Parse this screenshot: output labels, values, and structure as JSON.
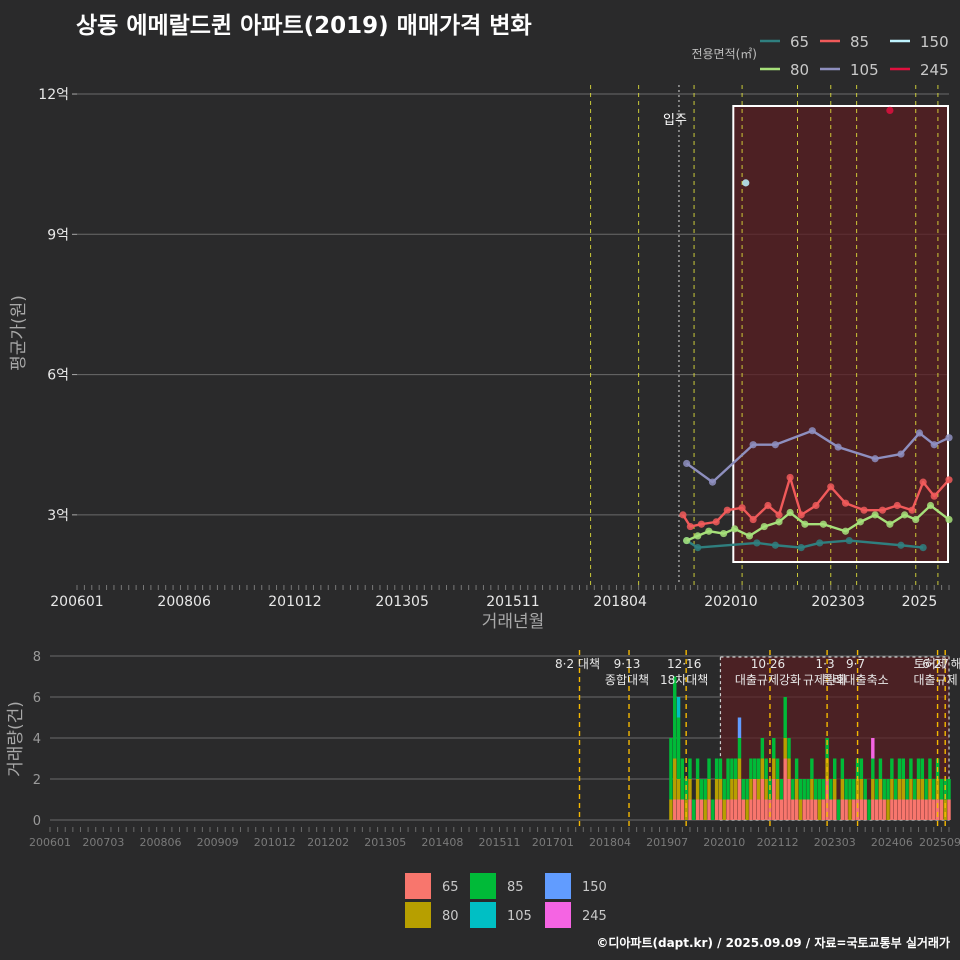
{
  "title": "상동 에메랄드퀸 아파트(2019) 매매가격 변화",
  "footer": "©디아파트(dapt.kr) / 2025.09.09 / 자료=국토교통부 실거래가",
  "colors": {
    "background": "#2a2a2b",
    "grid": "#6b6b6b",
    "axis_text": "#e8e8e8",
    "policy_line": "#f5b800",
    "highlight_fill": "#5a1e22",
    "highlight_border": "#ffffff",
    "line_colors": {
      "65": "#2f7f7f",
      "80": "#a6e07a",
      "85": "#f05a5a",
      "105": "#8e8fbf",
      "150": "#bff4ff",
      "245": "#e0103e"
    },
    "bar_colors": {
      "65": "#f8766d",
      "80": "#b79f00",
      "85": "#00ba38",
      "105": "#00bfc4",
      "150": "#619cff",
      "245": "#f564e3"
    }
  },
  "chart_data": [
    {
      "type": "line",
      "title": "",
      "xlabel": "거래년월",
      "ylabel": "평균가(원)",
      "legend_title": "전용면적(㎡)",
      "legend_position": "top-right",
      "legend_entries": [
        "65",
        "85",
        "150",
        "80",
        "105",
        "245"
      ],
      "xlim": [
        "2006-01",
        "2025-09"
      ],
      "ylim": [
        1.5,
        12.3
      ],
      "yunit": "억",
      "y_ticks": [
        3,
        6,
        9,
        12
      ],
      "y_tick_labels": [
        "3억",
        "6억",
        "9억",
        "12억"
      ],
      "x_tick_labels": [
        "200601",
        "200806",
        "201012",
        "201305",
        "201511",
        "201804",
        "202010",
        "202303",
        "2025"
      ],
      "annotation": "입주",
      "move_in_date": "2019-09",
      "highlight_period": [
        "2020-09",
        "2025-09"
      ],
      "policy_dates": [
        "2017-08",
        "2018-09",
        "2019-12",
        "2021-01",
        "2022-04",
        "2023-01",
        "2023-08",
        "2024-12",
        "2025-06"
      ],
      "series": [
        {
          "name": "65",
          "points": [
            [
              "2019-10",
              2.45
            ],
            [
              "2020-01",
              2.3
            ],
            [
              "2021-05",
              2.4
            ],
            [
              "2021-10",
              2.35
            ],
            [
              "2022-05",
              2.3
            ],
            [
              "2022-10",
              2.4
            ],
            [
              "2023-06",
              2.45
            ],
            [
              "2024-08",
              2.35
            ],
            [
              "2025-02",
              2.3
            ]
          ]
        },
        {
          "name": "80",
          "points": [
            [
              "2019-10",
              2.45
            ],
            [
              "2020-01",
              2.55
            ],
            [
              "2020-04",
              2.65
            ],
            [
              "2020-08",
              2.6
            ],
            [
              "2020-11",
              2.7
            ],
            [
              "2021-03",
              2.55
            ],
            [
              "2021-07",
              2.75
            ],
            [
              "2021-11",
              2.85
            ],
            [
              "2022-02",
              3.05
            ],
            [
              "2022-06",
              2.8
            ],
            [
              "2022-11",
              2.8
            ],
            [
              "2023-05",
              2.65
            ],
            [
              "2023-09",
              2.85
            ],
            [
              "2024-01",
              3.0
            ],
            [
              "2024-05",
              2.8
            ],
            [
              "2024-09",
              3.0
            ],
            [
              "2024-12",
              2.9
            ],
            [
              "2025-04",
              3.2
            ],
            [
              "2025-09",
              2.9
            ]
          ]
        },
        {
          "name": "85",
          "points": [
            [
              "2019-09",
              3.0
            ],
            [
              "2019-11",
              2.75
            ],
            [
              "2020-02",
              2.8
            ],
            [
              "2020-06",
              2.85
            ],
            [
              "2020-09",
              3.1
            ],
            [
              "2021-01",
              3.15
            ],
            [
              "2021-04",
              2.9
            ],
            [
              "2021-08",
              3.2
            ],
            [
              "2021-11",
              3.0
            ],
            [
              "2022-02",
              3.8
            ],
            [
              "2022-05",
              3.0
            ],
            [
              "2022-09",
              3.2
            ],
            [
              "2023-01",
              3.6
            ],
            [
              "2023-05",
              3.25
            ],
            [
              "2023-10",
              3.1
            ],
            [
              "2024-03",
              3.1
            ],
            [
              "2024-07",
              3.2
            ],
            [
              "2024-11",
              3.1
            ],
            [
              "2025-02",
              3.7
            ],
            [
              "2025-05",
              3.4
            ],
            [
              "2025-09",
              3.75
            ]
          ]
        },
        {
          "name": "105",
          "points": [
            [
              "2019-10",
              4.1
            ],
            [
              "2020-05",
              3.7
            ],
            [
              "2021-04",
              4.5
            ],
            [
              "2021-10",
              4.5
            ],
            [
              "2022-08",
              4.8
            ],
            [
              "2023-03",
              4.45
            ],
            [
              "2024-01",
              4.2
            ],
            [
              "2024-08",
              4.3
            ],
            [
              "2025-01",
              4.75
            ],
            [
              "2025-05",
              4.5
            ],
            [
              "2025-09",
              4.65
            ]
          ]
        },
        {
          "name": "150",
          "points": [
            [
              "2021-02",
              10.1
            ]
          ]
        },
        {
          "name": "245",
          "points": [
            [
              "2024-05",
              11.65
            ]
          ]
        }
      ]
    },
    {
      "type": "bar",
      "title": "",
      "xlabel": "",
      "ylabel": "거래량(건)",
      "legend_position": "bottom",
      "legend_entries": [
        "65",
        "85",
        "150",
        "80",
        "105",
        "245"
      ],
      "ylim": [
        0,
        8
      ],
      "y_ticks": [
        0,
        2,
        4,
        6,
        8
      ],
      "x_tick_labels": [
        "200601",
        "200703",
        "200806",
        "200909",
        "201012",
        "201202",
        "201305",
        "201408",
        "201511",
        "201701",
        "201804",
        "201907",
        "202010",
        "202112",
        "202303",
        "202406",
        "202509"
      ],
      "highlight_period": [
        "2020-09",
        "2025-09"
      ],
      "policy_annotations": [
        {
          "date": "2017-08",
          "lines": [
            "8·2 대책"
          ]
        },
        {
          "date": "2018-09",
          "lines": [
            "9·13",
            "종합대책"
          ]
        },
        {
          "date": "2019-12",
          "lines": [
            "12·16",
            "18차대책"
          ]
        },
        {
          "date": "2021-10",
          "lines": [
            "10·26",
            "대출규제강화"
          ]
        },
        {
          "date": "2023-01",
          "lines": [
            "1·3",
            "규제완화"
          ]
        },
        {
          "date": "2023-09",
          "lines": [
            "9·7",
            "특례대출축소"
          ]
        },
        {
          "date": "2025-06",
          "lines": [
            "6·27",
            "대출규제"
          ]
        },
        {
          "date": "2025-08",
          "lines": [
            "토허제 해제"
          ]
        }
      ],
      "months": [
        "2019-08",
        "2019-09",
        "2019-10",
        "2019-11",
        "2019-12",
        "2020-01",
        "2020-02",
        "2020-03",
        "2020-04",
        "2020-05",
        "2020-06",
        "2020-07",
        "2020-08",
        "2020-09",
        "2020-10",
        "2020-11",
        "2020-12",
        "2021-01",
        "2021-02",
        "2021-03",
        "2021-04",
        "2021-05",
        "2021-06",
        "2021-07",
        "2021-08",
        "2021-09",
        "2021-10",
        "2021-11",
        "2021-12",
        "2022-01",
        "2022-02",
        "2022-03",
        "2022-04",
        "2022-05",
        "2022-06",
        "2022-07",
        "2022-08",
        "2022-09",
        "2022-10",
        "2022-11",
        "2022-12",
        "2023-01",
        "2023-02",
        "2023-03",
        "2023-04",
        "2023-05",
        "2023-06",
        "2023-07",
        "2023-08",
        "2023-09",
        "2023-10",
        "2023-11",
        "2023-12",
        "2024-01",
        "2024-02",
        "2024-03",
        "2024-04",
        "2024-05",
        "2024-06",
        "2024-07",
        "2024-08",
        "2024-09",
        "2024-10",
        "2024-11",
        "2024-12",
        "2025-01",
        "2025-02",
        "2025-03",
        "2025-04",
        "2025-05",
        "2025-06",
        "2025-07",
        "2025-08",
        "2025-09"
      ],
      "series": [
        {
          "name": "65",
          "values": [
            0,
            1,
            1,
            1,
            0,
            1,
            0,
            1,
            1,
            0,
            1,
            0,
            1,
            1,
            0,
            1,
            1,
            1,
            2,
            1,
            0,
            1,
            2,
            1,
            2,
            1,
            1,
            2,
            1,
            1,
            3,
            2,
            1,
            1,
            0,
            1,
            1,
            1,
            1,
            0,
            1,
            2,
            1,
            1,
            0,
            1,
            1,
            0,
            1,
            1,
            1,
            1,
            0,
            1,
            1,
            1,
            1,
            0,
            1,
            1,
            1,
            1,
            1,
            1,
            1,
            1,
            1,
            1,
            1,
            1,
            1,
            1,
            0,
            1
          ]
        },
        {
          "name": "80",
          "values": [
            1,
            2,
            1,
            0,
            1,
            1,
            0,
            1,
            0,
            1,
            1,
            0,
            1,
            1,
            1,
            0,
            1,
            1,
            1,
            0,
            1,
            1,
            0,
            1,
            1,
            1,
            0,
            1,
            1,
            0,
            1,
            1,
            0,
            1,
            1,
            0,
            0,
            1,
            0,
            1,
            0,
            1,
            0,
            1,
            0,
            1,
            0,
            1,
            0,
            1,
            1,
            0,
            0,
            1,
            0,
            1,
            0,
            1,
            1,
            0,
            1,
            1,
            0,
            1,
            0,
            1,
            1,
            0,
            1,
            0,
            1,
            0,
            1,
            0
          ]
        },
        {
          "name": "85",
          "values": [
            3,
            4,
            3,
            2,
            1,
            1,
            1,
            1,
            1,
            1,
            1,
            1,
            1,
            1,
            1,
            2,
            1,
            1,
            1,
            1,
            1,
            1,
            1,
            1,
            1,
            1,
            1,
            1,
            1,
            1,
            2,
            1,
            1,
            1,
            1,
            1,
            1,
            1,
            1,
            1,
            1,
            1,
            1,
            1,
            1,
            1,
            1,
            1,
            1,
            1,
            1,
            1,
            1,
            1,
            1,
            1,
            1,
            1,
            1,
            1,
            1,
            1,
            1,
            1,
            1,
            1,
            1,
            1,
            1,
            1,
            1,
            1,
            1,
            1
          ]
        },
        {
          "name": "105",
          "values": [
            0,
            0,
            1,
            0,
            0,
            0,
            0,
            0,
            0,
            0,
            0,
            0,
            0,
            0,
            0,
            0,
            0,
            0,
            0,
            0,
            0,
            0,
            0,
            0,
            0,
            0,
            0,
            0,
            0,
            0,
            0,
            0,
            0,
            0,
            0,
            0,
            0,
            0,
            0,
            0,
            0,
            0,
            0,
            0,
            0,
            0,
            0,
            0,
            0,
            0,
            0,
            0,
            0,
            0,
            0,
            0,
            0,
            0,
            0,
            0,
            0,
            0,
            0,
            0,
            0,
            0,
            0,
            0,
            0,
            0,
            0,
            0,
            0,
            0
          ]
        },
        {
          "name": "150",
          "values": [
            0,
            0,
            0,
            0,
            0,
            0,
            0,
            0,
            0,
            0,
            0,
            0,
            0,
            0,
            0,
            0,
            0,
            0,
            1,
            0,
            0,
            0,
            0,
            0,
            0,
            0,
            0,
            0,
            0,
            0,
            0,
            0,
            0,
            0,
            0,
            0,
            0,
            0,
            0,
            0,
            0,
            0,
            0,
            0,
            0,
            0,
            0,
            0,
            0,
            0,
            0,
            0,
            0,
            0,
            0,
            0,
            0,
            0,
            0,
            0,
            0,
            0,
            0,
            0,
            0,
            0,
            0,
            0,
            0,
            0,
            0,
            0,
            0,
            0
          ]
        },
        {
          "name": "245",
          "values": [
            0,
            0,
            0,
            0,
            0,
            0,
            0,
            0,
            0,
            0,
            0,
            0,
            0,
            0,
            0,
            0,
            0,
            0,
            0,
            0,
            0,
            0,
            0,
            0,
            0,
            0,
            0,
            0,
            0,
            0,
            0,
            0,
            0,
            0,
            0,
            0,
            0,
            0,
            0,
            0,
            0,
            0,
            0,
            0,
            0,
            0,
            0,
            0,
            0,
            0,
            0,
            0,
            0,
            1,
            0,
            0,
            0,
            0,
            0,
            0,
            0,
            0,
            0,
            0,
            0,
            0,
            0,
            0,
            0,
            0,
            0,
            0,
            0,
            0
          ]
        }
      ]
    }
  ]
}
